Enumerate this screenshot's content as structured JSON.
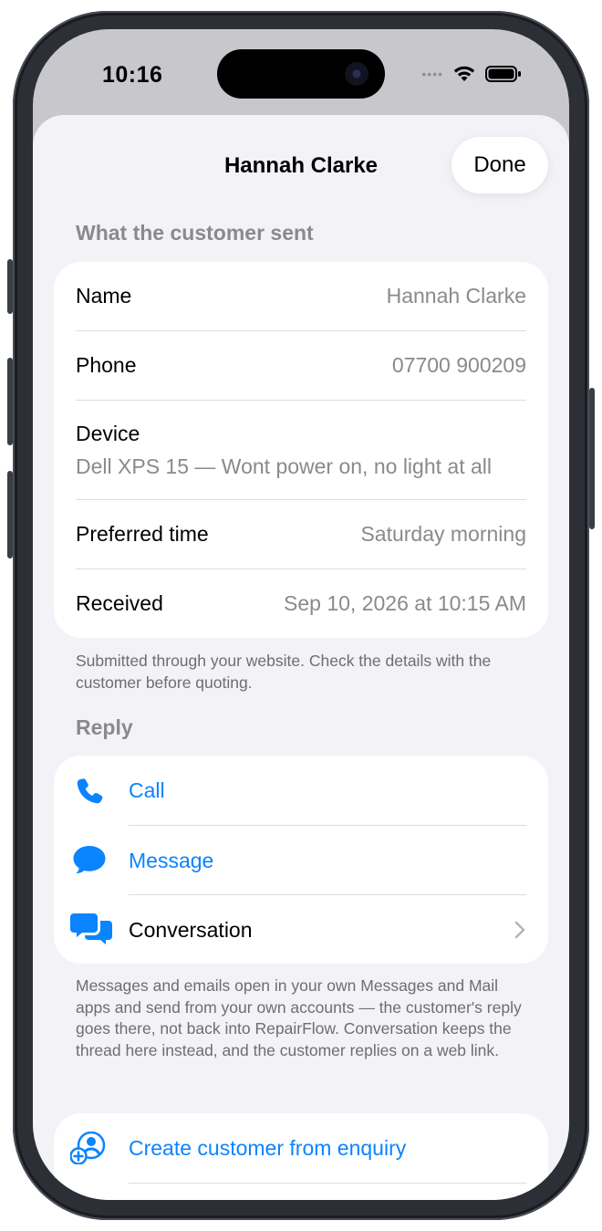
{
  "status_bar": {
    "time": "10:16"
  },
  "nav": {
    "title": "Hannah Clarke",
    "done_label": "Done"
  },
  "enquiry": {
    "section_title": "What the customer sent",
    "rows": {
      "name": {
        "label": "Name",
        "value": "Hannah Clarke"
      },
      "phone": {
        "label": "Phone",
        "value": "07700 900209"
      },
      "device": {
        "label": "Device",
        "value": "Dell XPS 15 — Wont power on, no light at all"
      },
      "preferred_time": {
        "label": "Preferred time",
        "value": "Saturday morning"
      },
      "received": {
        "label": "Received",
        "value": "Sep 10, 2026 at 10:15 AM"
      }
    },
    "footer": "Submitted through your website. Check the details with the customer before quoting."
  },
  "reply": {
    "section_title": "Reply",
    "actions": {
      "call": {
        "label": "Call",
        "icon": "phone-icon"
      },
      "message": {
        "label": "Message",
        "icon": "message-bubble-icon"
      },
      "conversation": {
        "label": "Conversation",
        "icon": "conversation-bubbles-icon"
      }
    },
    "footer": "Messages and emails open in your own Messages and Mail apps and send from your own accounts — the customer's reply goes there, not back into RepairFlow. Conversation keeps the thread here instead, and the customer replies on a web link."
  },
  "customer": {
    "create_label": "Create customer from enquiry",
    "icon": "person-add-icon"
  },
  "colors": {
    "accent": "#0a84ff",
    "background": "#f2f2f7",
    "secondary_text": "#8a8a8e"
  }
}
